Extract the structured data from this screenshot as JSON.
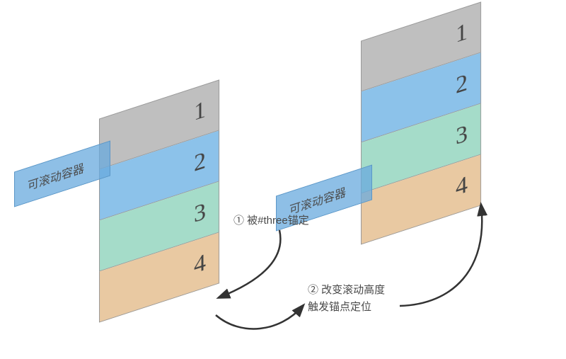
{
  "colors": {
    "row_gray": "#bfbfbf",
    "row_blue": "#8cc2ea",
    "row_teal": "#a5dcc9",
    "row_tan": "#e9c9a2",
    "tag_fill": "rgba(104,170,222,0.75)"
  },
  "left_stack": {
    "rows": [
      "1",
      "2",
      "3",
      "4"
    ]
  },
  "right_stack": {
    "rows": [
      "1",
      "2",
      "3",
      "4"
    ]
  },
  "label_scroll_container": "可滚动容器",
  "caption_a": "① 被#three锚定",
  "caption_b_line1": "② 改变滚动高度",
  "caption_b_line2": "触发锚点定位"
}
